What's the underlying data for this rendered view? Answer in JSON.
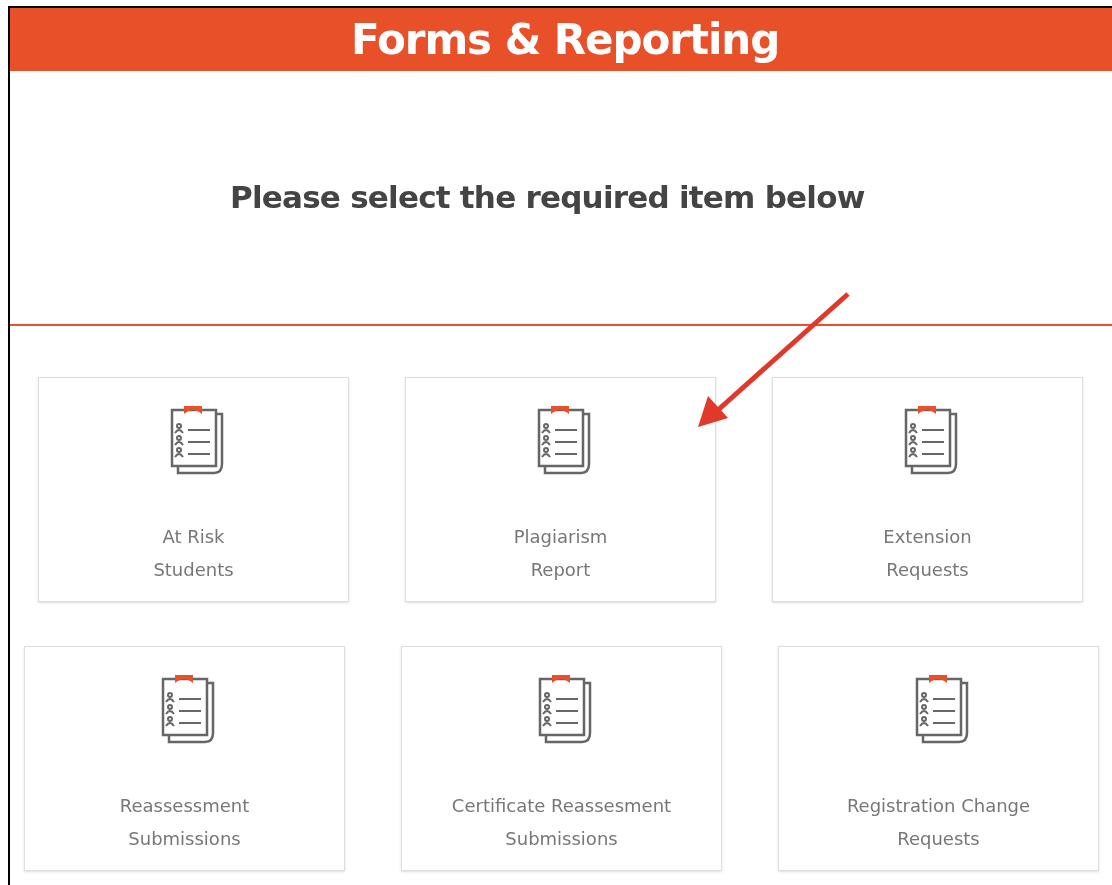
{
  "header": {
    "title": "Forms & Reporting"
  },
  "prompt": "Please select the required item below",
  "cards": [
    {
      "label": "At Risk\nStudents"
    },
    {
      "label": "Plagiarism\nReport"
    },
    {
      "label": "Extension\nRequests"
    },
    {
      "label": "Reassessment\nSubmissions"
    },
    {
      "label": "Certificate Reassesment\nSubmissions"
    },
    {
      "label": "Registration Change\nRequests"
    }
  ]
}
